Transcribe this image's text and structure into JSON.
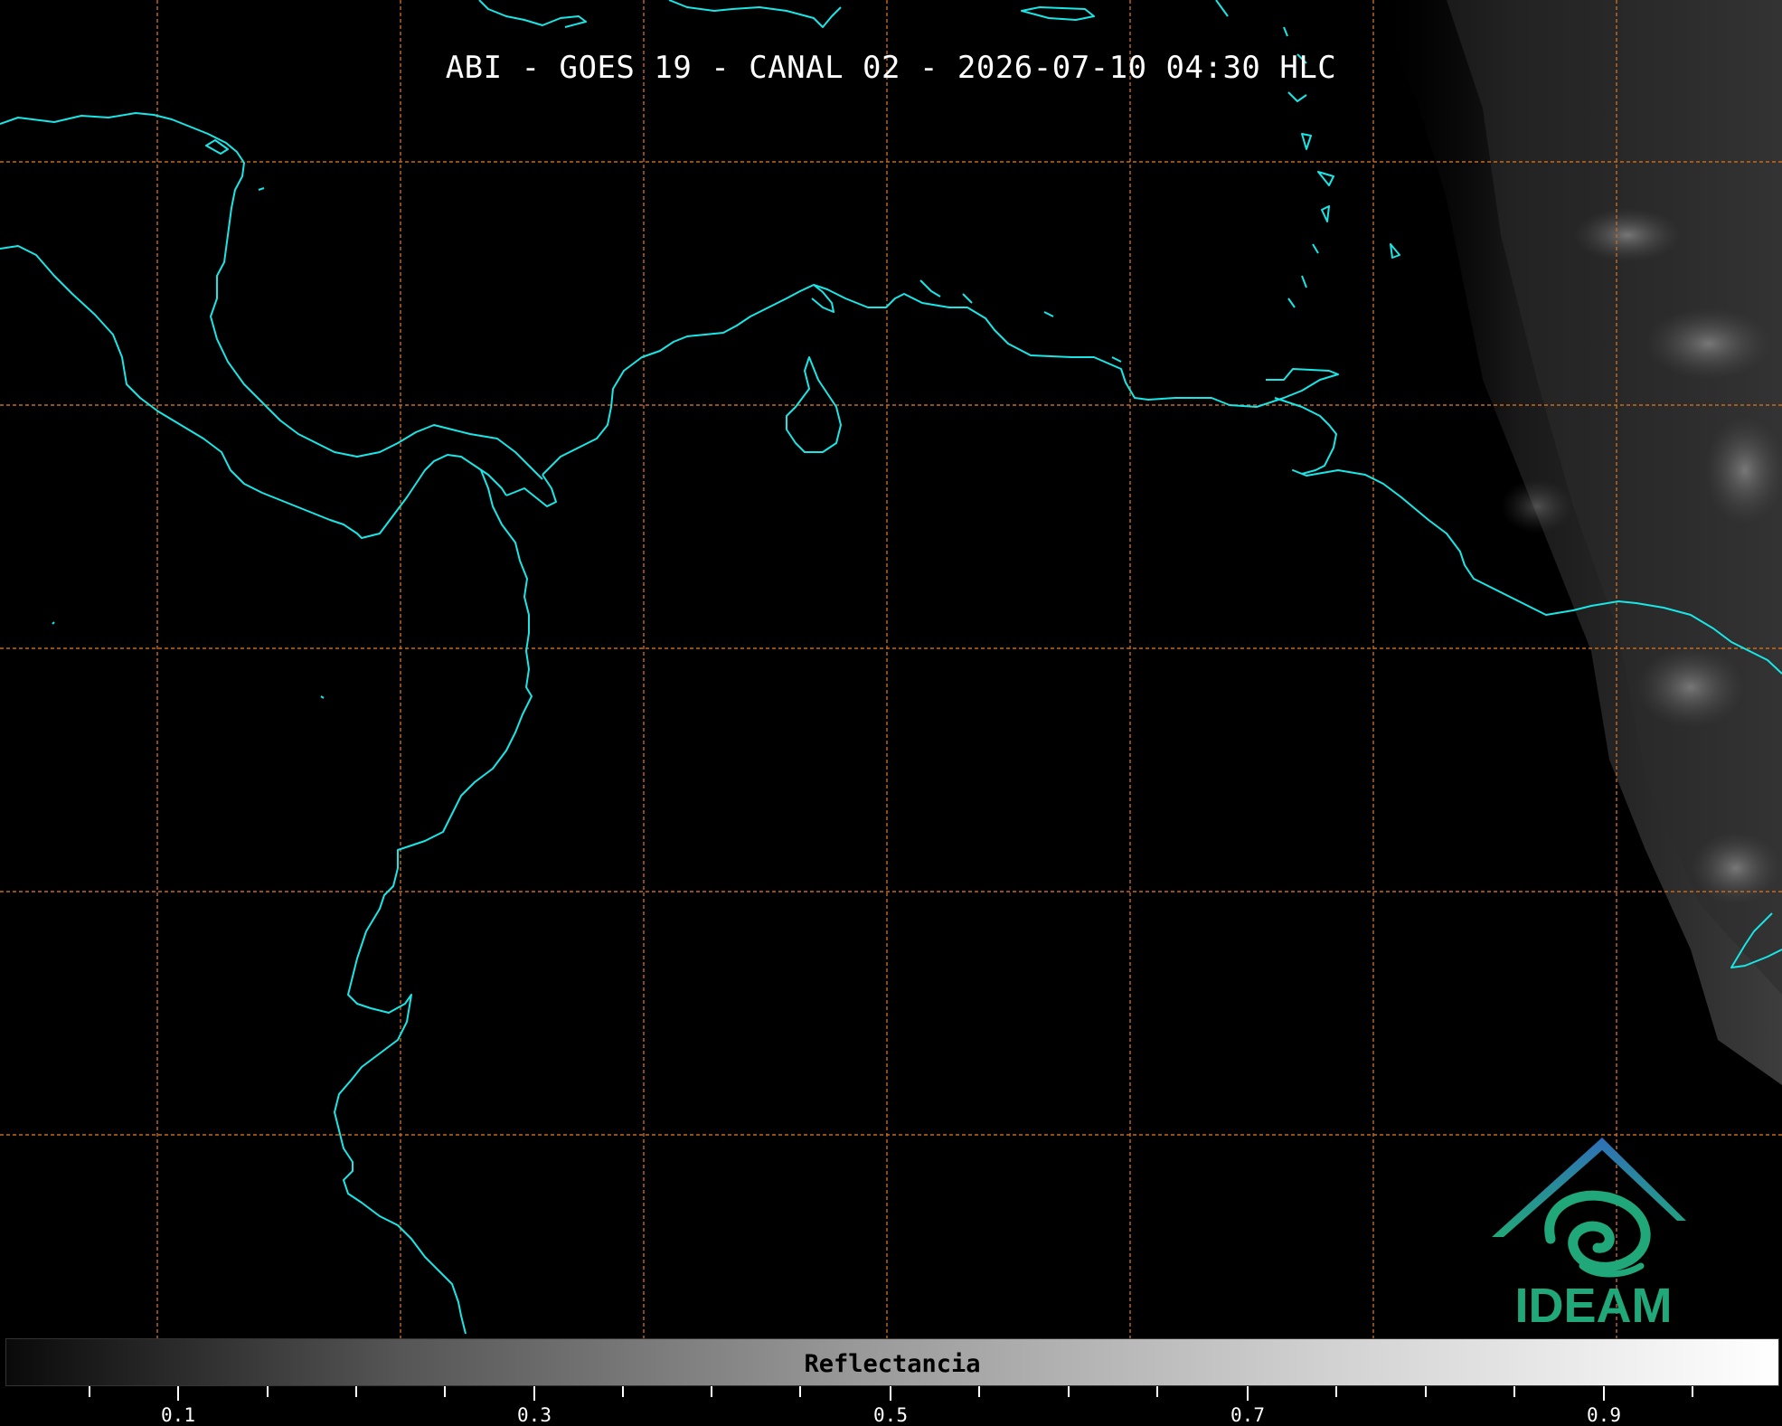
{
  "title": "ABI - GOES 19 - CANAL 02 - 2026-07-10 04:30 HLC",
  "colorbar": {
    "label": "Reflectancia",
    "tick_labels": [
      "0.1",
      "0.3",
      "0.5",
      "0.7",
      "0.9"
    ],
    "min": 0.0,
    "max": 1.0
  },
  "logo": {
    "text": "IDEAM"
  },
  "colors": {
    "coastline": "#19e6e6",
    "gridline": "#c46a1e",
    "background": "#000000",
    "logo_teal": "#21a87a",
    "logo_blue": "#2f6fb8"
  }
}
